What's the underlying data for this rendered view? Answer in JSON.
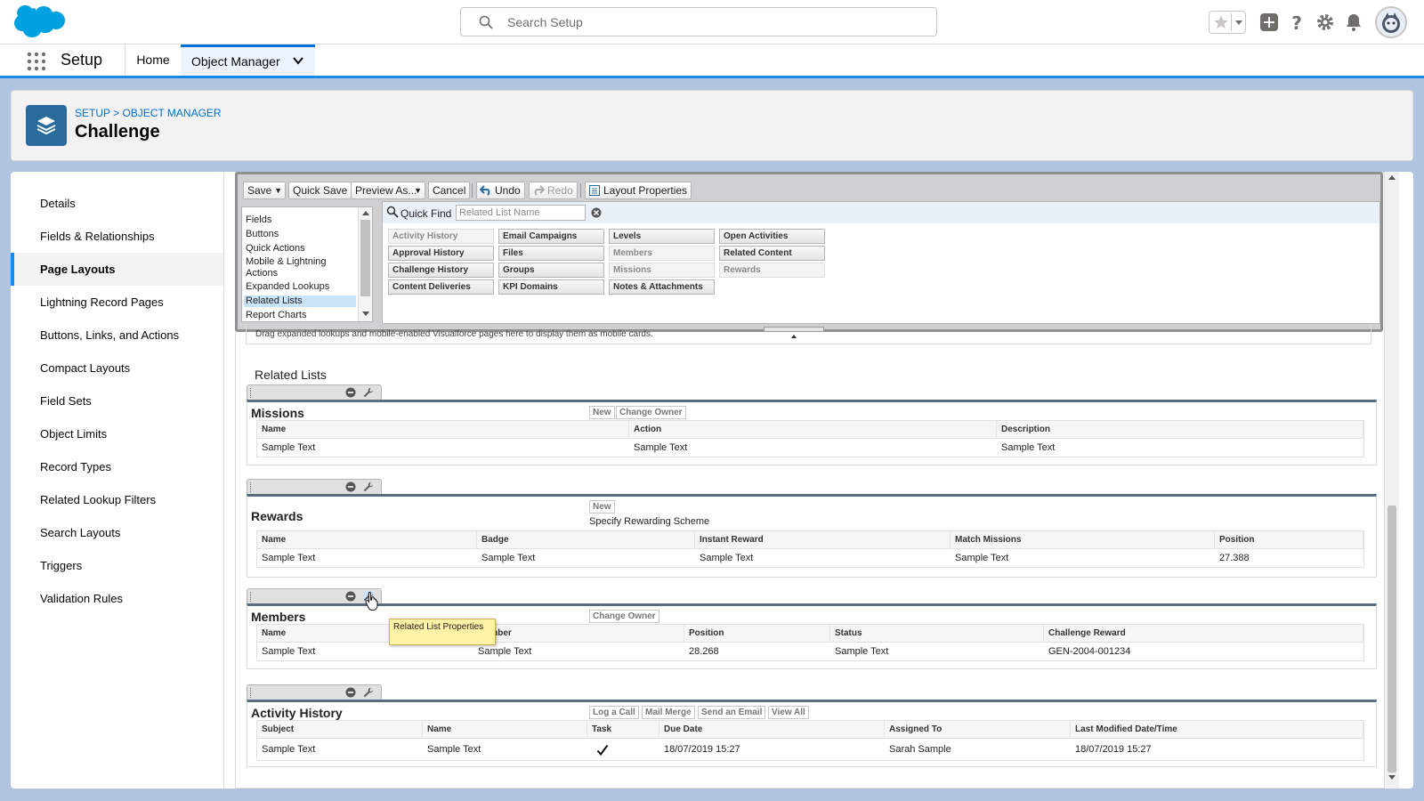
{
  "header": {
    "search_placeholder": "Search Setup"
  },
  "nav": {
    "app_name": "Setup",
    "tabs": [
      {
        "label": "Home"
      },
      {
        "label": "Object Manager"
      }
    ]
  },
  "page": {
    "breadcrumb": "SETUP > OBJECT MANAGER",
    "title": "Challenge"
  },
  "sidenav": {
    "items": [
      {
        "label": "Details"
      },
      {
        "label": "Fields & Relationships"
      },
      {
        "label": "Page Layouts"
      },
      {
        "label": "Lightning Record Pages"
      },
      {
        "label": "Buttons, Links, and Actions"
      },
      {
        "label": "Compact Layouts"
      },
      {
        "label": "Field Sets"
      },
      {
        "label": "Object Limits"
      },
      {
        "label": "Record Types"
      },
      {
        "label": "Related Lookup Filters"
      },
      {
        "label": "Search Layouts"
      },
      {
        "label": "Triggers"
      },
      {
        "label": "Validation Rules"
      }
    ],
    "active_index": 2
  },
  "toolbar": {
    "save": "Save",
    "quick_save": "Quick Save",
    "preview_as": "Preview As...",
    "cancel": "Cancel",
    "undo": "Undo",
    "redo": "Redo",
    "layout_properties": "Layout Properties"
  },
  "palette": {
    "categories": [
      "Fields",
      "Buttons",
      "Quick Actions",
      "Mobile & Lightning Actions",
      "Expanded Lookups",
      "Related Lists",
      "Report Charts"
    ],
    "selected_category": "Related Lists",
    "quick_find_label": "Quick Find",
    "quick_find_placeholder": "Related List Name",
    "items": {
      "col1": [
        "Activity History",
        "Approval History",
        "Challenge History",
        "Content Deliveries"
      ],
      "col2": [
        "Email Campaigns",
        "Files",
        "Groups",
        "KPI Domains"
      ],
      "col3": [
        "Levels",
        "Members",
        "Missions",
        "Notes & Attachments"
      ],
      "col4": [
        "Open Activities",
        "Related Content",
        "Rewards"
      ]
    }
  },
  "hint_text": "Drag expanded lookups and mobile-enabled Visualforce pages here to display them as mobile cards.",
  "section_title": "Related Lists",
  "related_lists": {
    "missions": {
      "title": "Missions",
      "buttons": [
        "New",
        "Change Owner"
      ],
      "columns": [
        "Name",
        "Action",
        "Description"
      ],
      "row": [
        "Sample Text",
        "Sample Text",
        "Sample Text"
      ]
    },
    "rewards": {
      "title": "Rewards",
      "buttons": [
        "New"
      ],
      "custom_link": "Specify Rewarding Scheme",
      "columns": [
        "Name",
        "Badge",
        "Instant Reward",
        "Match Missions",
        "Position"
      ],
      "row": [
        "Sample Text",
        "Sample Text",
        "Sample Text",
        "Sample Text",
        "27.388"
      ]
    },
    "members": {
      "title": "Members",
      "buttons": [
        "Change Owner"
      ],
      "columns": [
        "Name",
        "Number",
        "Position",
        "Status",
        "Challenge Reward"
      ],
      "row": [
        "Sample Text",
        "Sample Text",
        "28.268",
        "Sample Text",
        "GEN-2004-001234"
      ]
    },
    "activity_history": {
      "title": "Activity History",
      "buttons": [
        "Log a Call",
        "Mail Merge",
        "Send an Email",
        "View All"
      ],
      "columns": [
        "Subject",
        "Name",
        "Task",
        "Due Date",
        "Assigned To",
        "Last Modified Date/Time"
      ],
      "row": [
        "Sample Text",
        "Sample Text",
        "",
        "18/07/2019 15:27",
        "Sarah Sample",
        "18/07/2019 15:27"
      ]
    }
  },
  "tooltip": "Related List Properties",
  "colors": {
    "brand": "#1589ee",
    "link": "#0070d2",
    "object_icon": "#2a6b9c",
    "background": "#b0c4df"
  }
}
